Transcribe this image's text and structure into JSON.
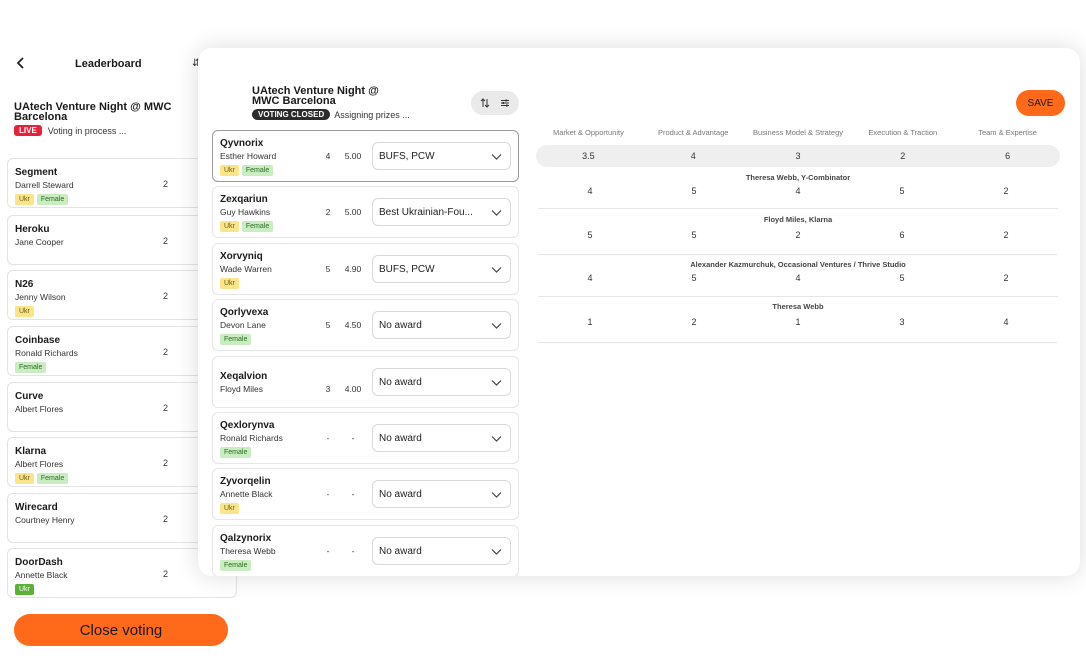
{
  "leaderboard": {
    "title": "Leaderboard",
    "sort_icon": "sort-arrows",
    "sort_glyph": "⇵",
    "event": "UAtech Venture Night @ MWC Barcelona",
    "live_badge": "LIVE",
    "status": "Voting in process ...",
    "cards": [
      {
        "name": "Segment",
        "judge": "Darrell Steward",
        "count": "2",
        "tags": [
          "Ukr",
          "Female"
        ]
      },
      {
        "name": "Heroku",
        "judge": "Jane Cooper",
        "count": "2",
        "tags": []
      },
      {
        "name": "N26",
        "judge": "Jenny Wilson",
        "count": "2",
        "tags": [
          "Ukr"
        ]
      },
      {
        "name": "Coinbase",
        "judge": "Ronald Richards",
        "count": "2",
        "tags": [
          "Female"
        ]
      },
      {
        "name": "Curve",
        "judge": "Albert Flores",
        "count": "2",
        "tags": []
      },
      {
        "name": "Klarna",
        "judge": "Albert Flores",
        "count": "2",
        "tags": [
          "Ukr",
          "Female"
        ]
      },
      {
        "name": "Wirecard",
        "judge": "Courtney Henry",
        "count": "2",
        "tags": []
      },
      {
        "name": "DoorDash",
        "judge": "Annette Black",
        "count": "2",
        "tags": [
          "Ukr"
        ]
      }
    ],
    "close_voting_label": "Close voting"
  },
  "modal": {
    "event": "UAtech Venture Night @ MWC Barcelona",
    "closed_badge": "VOTING CLOSED",
    "status": "Assigning prizes ...",
    "save_label": "SAVE",
    "startups": [
      {
        "name": "Qyvnorix",
        "judge": "Esther Howard",
        "count": "4",
        "avg": "5.00",
        "award": "BUFS, PCW",
        "tags": [
          "Ukr",
          "Female"
        ],
        "selected": true
      },
      {
        "name": "Zexqariun",
        "judge": "Guy Hawkins",
        "count": "2",
        "avg": "5.00",
        "award": "Best Ukrainian-Fou...",
        "tags": [
          "Ukr",
          "Female"
        ]
      },
      {
        "name": "Xorvyniq",
        "judge": "Wade Warren",
        "count": "5",
        "avg": "4.90",
        "award": "BUFS, PCW",
        "tags": [
          "Ukr"
        ]
      },
      {
        "name": "Qorlyvexa",
        "judge": "Devon Lane",
        "count": "5",
        "avg": "4.50",
        "award": "No award",
        "tags": [
          "Female"
        ]
      },
      {
        "name": "Xeqalvion",
        "judge": "Floyd Miles",
        "count": "3",
        "avg": "4.00",
        "award": "No award",
        "tags": []
      },
      {
        "name": "Qexlorynva",
        "judge": "Ronald Richards",
        "count": "-",
        "avg": "-",
        "award": "No award",
        "tags": [
          "Female"
        ]
      },
      {
        "name": "Zyvorqelin",
        "judge": "Annette Black",
        "count": "-",
        "avg": "-",
        "award": "No award",
        "tags": [
          "Ukr"
        ]
      },
      {
        "name": "Qalzynorix",
        "judge": "Theresa Webb",
        "count": "-",
        "avg": "-",
        "award": "No award",
        "tags": [
          "Female"
        ]
      }
    ],
    "criteria": [
      "Market & Opportunity",
      "Product & Advantage",
      "Business Model & Strategy",
      "Execution & Traction",
      "Team & Expertise"
    ],
    "averages": [
      "3.5",
      "4",
      "3",
      "2",
      "6"
    ],
    "judges": [
      {
        "name": "Theresa Webb, Y-Combinator",
        "scores": [
          "4",
          "5",
          "4",
          "5",
          "2"
        ]
      },
      {
        "name": "Floyd Miles, Klarna",
        "scores": [
          "5",
          "5",
          "2",
          "6",
          "2"
        ]
      },
      {
        "name": "Alexander Kazmurchuk, Occasional Ventures / Thrive Studio",
        "scores": [
          "4",
          "5",
          "4",
          "5",
          "2"
        ]
      },
      {
        "name": "Theresa Webb",
        "scores": [
          "1",
          "2",
          "1",
          "3",
          "4"
        ]
      }
    ]
  },
  "colors": {
    "accent": "#ff6a1a",
    "live": "#e8203a",
    "ukr_tag": "#fbe58a",
    "female_tag": "#c9ecc0"
  }
}
